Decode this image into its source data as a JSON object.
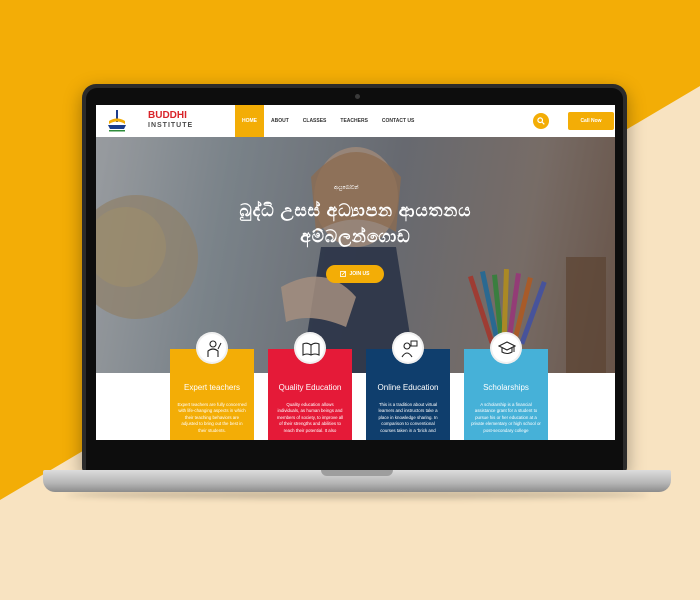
{
  "colors": {
    "accent": "#f3ad06",
    "background": "#f8e3c1",
    "brand_red": "#d9242a"
  },
  "site": {
    "brand_name": "BUDDHI",
    "brand_sub": "INSTITUTE",
    "logo_icon": "institute-logo-icon"
  },
  "nav": {
    "items": [
      {
        "label": "HOME",
        "active": true
      },
      {
        "label": "ABOUT",
        "active": false
      },
      {
        "label": "CLASSES",
        "active": false
      },
      {
        "label": "TEACHERS",
        "active": false
      },
      {
        "label": "CONTACT US",
        "active": false
      }
    ],
    "search_icon": "search-icon",
    "call_label": "Call Now"
  },
  "hero": {
    "eyebrow": "ආයුබෝවන්",
    "title_line1": "බුද්ධි උසස් අධ්‍යාපන ආයතනය",
    "title_line2": "අම්බලන්ගොඩ",
    "join_label": "JOIN US",
    "join_icon": "edit-icon"
  },
  "cards": [
    {
      "title": "Expert teachers",
      "color": "#f3ad06",
      "icon": "teacher-icon",
      "text": "Expert teachers are fully concerned with life-changing aspects in which their teaching behaviors are adjusted to bring out the best in their students."
    },
    {
      "title": "Quality Education",
      "color": "#e51a38",
      "icon": "open-book-icon",
      "text": "Quality education allows individuals, as human beings and members of society, to improve all of their strengths and abilities to reach their potential. It also"
    },
    {
      "title": "Online Education",
      "color": "#0f3e6d",
      "icon": "online-learning-icon",
      "text": "This is a tradition about virtual learners and instructors take a place in knowledge sharing. In comparison to conventional courses taken in a 'brick and"
    },
    {
      "title": "Scholarships",
      "color": "#46b1d8",
      "icon": "graduation-cap-icon",
      "text": "A scholarship is a financial assistance grant for a student to pursue his or her education at a private elementary or high school or post-secondary college"
    }
  ]
}
